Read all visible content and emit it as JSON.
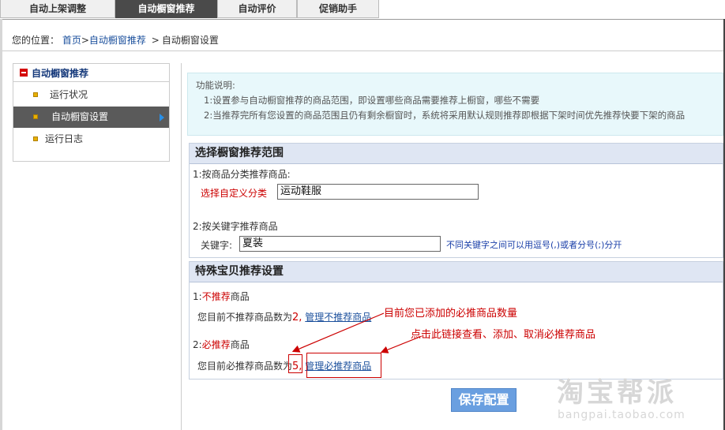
{
  "tabs": [
    "自动上架调整",
    "自动橱窗推荐",
    "自动评价",
    "促销助手"
  ],
  "breadcrumb": {
    "label": "您的位置：",
    "home": "首页",
    "section": "自动橱窗推荐",
    "current": "自动橱窗设置",
    "sep": ">"
  },
  "sidebar": {
    "title": "自动橱窗推荐",
    "items": [
      {
        "label": "运行状况"
      },
      {
        "label": "自动橱窗设置",
        "active": true
      },
      {
        "label": "运行日志"
      }
    ]
  },
  "info": {
    "title": "功能说明:",
    "line1": "1:设置参与自动橱窗推荐的商品范围，即设置哪些商品需要推荐上橱窗，哪些不需要",
    "line2": "2:当推荐完所有您设置的商品范围且仍有剩余橱窗时，系统将采用默认规则推荐即根据下架时间优先推荐快要下架的商品"
  },
  "range_panel": {
    "title": "选择橱窗推荐范围",
    "by_category": "1:按商品分类推荐商品:",
    "category_label": "选择自定义分类",
    "category_value": "运动鞋服",
    "by_keyword": "2:按关键字推荐商品",
    "keyword_label": "关键字:",
    "keyword_value": "夏装",
    "keyword_hint": "不同关键字之间可以用逗号(,)或者分号(;)分开"
  },
  "special_panel": {
    "title": "特殊宝贝推荐设置",
    "no_rec_prefix": "1:",
    "no_rec_red": "不推荐",
    "no_rec_suffix": "商品",
    "no_rec_count_text": "您目前不推荐商品数为",
    "no_rec_count": "2,",
    "no_rec_link": "管理不推荐商品",
    "must_prefix": "2:",
    "must_red": "必推荐",
    "must_suffix": "商品",
    "must_count_text": "您目前必推荐商品数为",
    "must_count": "5,",
    "must_link": "管理必推荐商品"
  },
  "save_button": "保存配置",
  "annotations": {
    "count_note": "目前您已添加的必推商品数量",
    "link_note": "点击此链接查看、添加、取消必推荐商品"
  },
  "watermark": {
    "logo": "淘宝帮派",
    "url": "bangpai.taobao.com"
  },
  "colors": {
    "accent_red": "#cc0000",
    "panel_header": "#dfe6f3",
    "info_bg": "#e8f8fb",
    "button": "#6a9fe0"
  }
}
